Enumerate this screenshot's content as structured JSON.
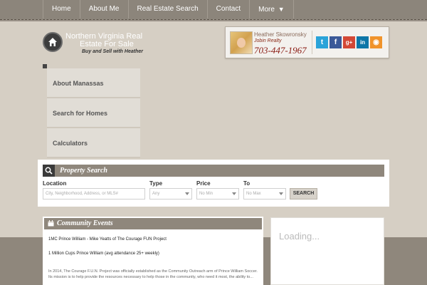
{
  "nav": {
    "items": [
      {
        "label": "Home"
      },
      {
        "label": "About Me"
      },
      {
        "label": "Real Estate Search"
      },
      {
        "label": "Contact"
      },
      {
        "label": "More",
        "caret": "▼"
      }
    ]
  },
  "logo": {
    "line1": "Northern Virginia Real",
    "line2": "Estate For Sale",
    "tagline": "Buy and Sell with Heather"
  },
  "agent": {
    "name": "Heather Skowronsky",
    "company": "Jobin Realty",
    "phone": "703-447-1967"
  },
  "social": [
    {
      "icon": "twitter-icon",
      "glyph": "t",
      "color": "#2aa3d9"
    },
    {
      "icon": "facebook-icon",
      "glyph": "f",
      "color": "#3b5998"
    },
    {
      "icon": "google-plus-icon",
      "glyph": "g+",
      "color": "#d34836"
    },
    {
      "icon": "linkedin-icon",
      "glyph": "in",
      "color": "#0e76a8"
    },
    {
      "icon": "rss-icon",
      "glyph": "◉",
      "color": "#f0932b"
    }
  ],
  "side_menu": {
    "items": [
      {
        "label": "About Manassas"
      },
      {
        "label": "Search for Homes"
      },
      {
        "label": "Calculators"
      }
    ]
  },
  "search": {
    "title": "Property Search",
    "location": {
      "label": "Location",
      "placeholder": "City, Neighborhood, Address, or MLS#"
    },
    "type": {
      "label": "Type",
      "value": "Any"
    },
    "price": {
      "label": "Price",
      "value": "No Min"
    },
    "to": {
      "label": "To",
      "value": "No Max"
    },
    "button": "SEARCH"
  },
  "events": {
    "title": "Community Events",
    "items": [
      {
        "label": "1MC Prince William - Mike Yeatts of The Courage FUN Project"
      },
      {
        "label": "1 Million Cups Prince William (avg attendance 25+ weekly)"
      }
    ],
    "body": "In 2014, The Courage F.U.N. Project was officially established as the Community Outreach arm of Prince William Soccer. Its mission is to help provide the resources necessary to help those in the community, who need it most, the ability to..."
  },
  "loading": {
    "text": "Loading..."
  },
  "colors": {
    "background": "#d6cfc4",
    "band": "#8f877c",
    "phone": "#8a1a12"
  }
}
